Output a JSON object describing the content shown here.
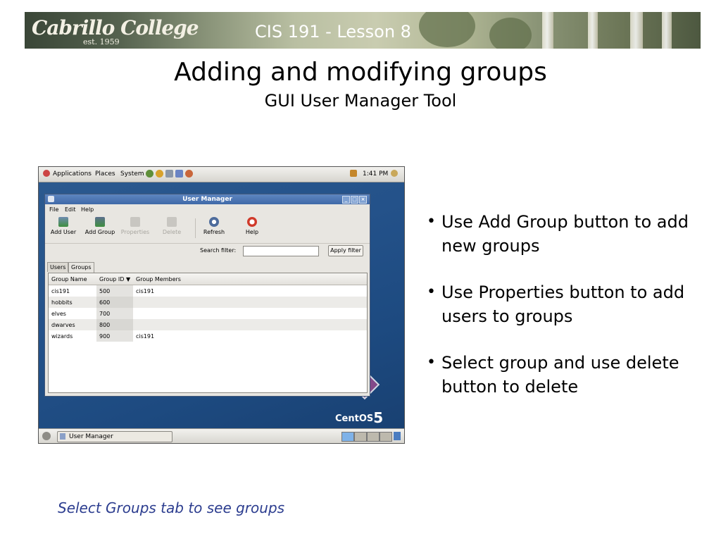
{
  "banner": {
    "logo": "Cabrillo College",
    "logo_sub": "est. 1959",
    "title": "CIS 191 - Lesson 8"
  },
  "slide": {
    "title": "Adding and modifying groups",
    "subtitle": "GUI User Manager Tool"
  },
  "desktop": {
    "panel": {
      "applications": "Applications",
      "places": "Places",
      "system": "System",
      "clock": "1:41 PM"
    },
    "taskbar": {
      "task": "User Manager"
    },
    "branding": {
      "name": "CentOS",
      "version": "5"
    }
  },
  "window": {
    "title": "User Manager",
    "menu": [
      "File",
      "Edit",
      "Help"
    ],
    "toolbar": {
      "add_user": "Add User",
      "add_group": "Add Group",
      "properties": "Properties",
      "delete": "Delete",
      "refresh": "Refresh",
      "help": "Help"
    },
    "search_label": "Search filter:",
    "search_value": "",
    "apply_filter": "Apply filter",
    "tabs": [
      "Users",
      "Groups"
    ],
    "active_tab": "Groups",
    "columns": [
      "Group Name",
      "Group ID",
      "Group Members"
    ],
    "sort_indicator": "▼",
    "rows": [
      {
        "name": "cis191",
        "id": "500",
        "members": "cis191"
      },
      {
        "name": "hobbits",
        "id": "600",
        "members": ""
      },
      {
        "name": "elves",
        "id": "700",
        "members": ""
      },
      {
        "name": "dwarves",
        "id": "800",
        "members": ""
      },
      {
        "name": "wizards",
        "id": "900",
        "members": "cis191"
      }
    ]
  },
  "bullets": [
    "Use Add Group button to add new groups",
    "Use Properties button to add users to groups",
    "Select group and use delete button to delete"
  ],
  "caption": "Select Groups tab to see groups",
  "colors": {
    "caption": "#2c3d8f",
    "desktop": "#24528a",
    "titlebar": "#4a74b2"
  }
}
